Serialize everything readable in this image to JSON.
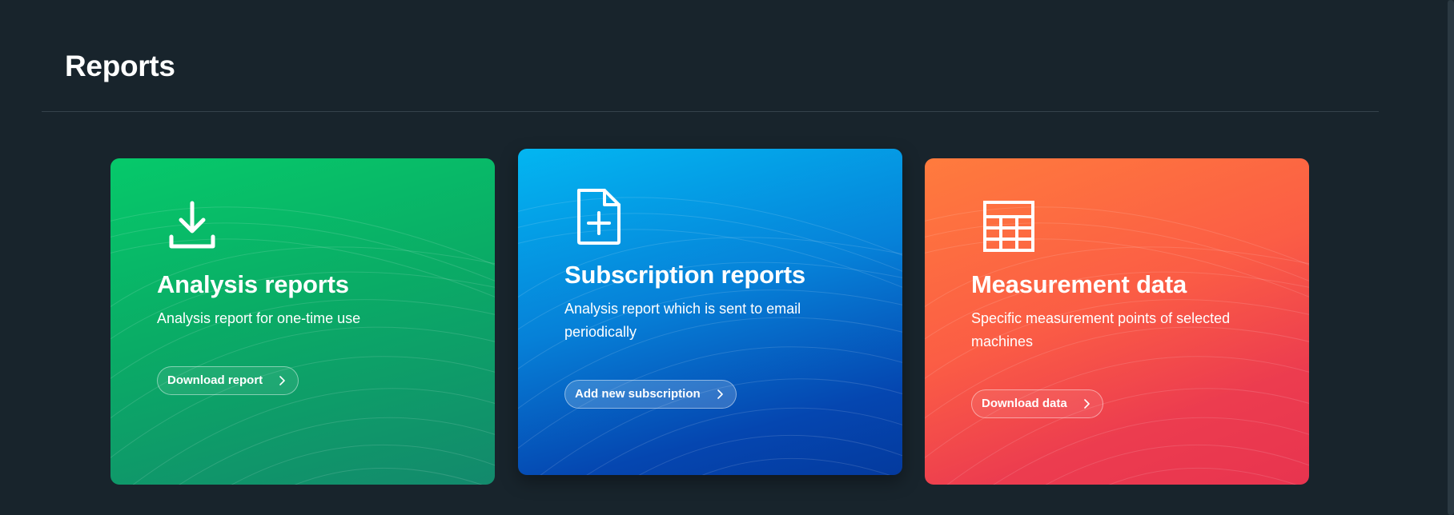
{
  "page": {
    "title": "Reports"
  },
  "cards": [
    {
      "title": "Analysis reports",
      "description": "Analysis report for one-time use",
      "button_label": "Download report",
      "icon": "download-icon",
      "color_start": "#06c96a",
      "color_end": "#13896c"
    },
    {
      "title": "Subscription reports",
      "description": "Analysis report which is sent to email periodically",
      "button_label": "Add new subscription",
      "icon": "add-document-icon",
      "color_start": "#03b6f1",
      "color_end": "#043a9e"
    },
    {
      "title": "Measurement data",
      "description": "Specific measurement points of selected machines",
      "button_label": "Download data",
      "icon": "table-icon",
      "color_start": "#ff7b3d",
      "color_end": "#e8344f"
    }
  ],
  "colors": {
    "background": "#18242c",
    "divider": "#35424b"
  }
}
